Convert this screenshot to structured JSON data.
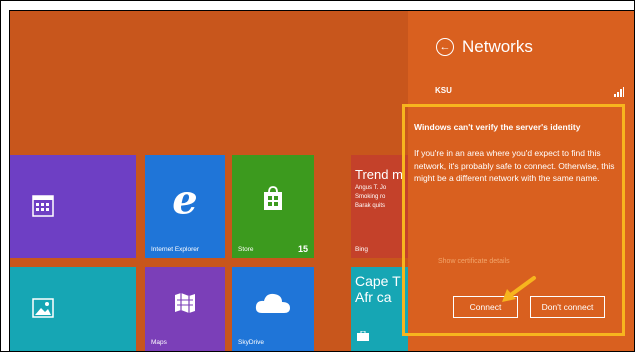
{
  "networks_panel": {
    "title": "Networks",
    "network_name": "KSU",
    "warning_heading": "Windows can't verify the server's identity",
    "warning_body": "If you're in an area where you'd expect to find this network, it's probably safe to connect. Otherwise, this might be a different network with the same name.",
    "details_link": "Show certificate details",
    "connect_label": "Connect",
    "dont_connect_label": "Don't connect"
  },
  "tiles": {
    "ie_label": "Internet Explorer",
    "store_label": "Store",
    "store_badge": "15",
    "news_headline": "Trend m",
    "news_line1": "Angus T. Jo",
    "news_line2": "Smoking ro",
    "news_line3": "Barak quits",
    "news_label": "Bing",
    "maps_label": "Maps",
    "skydrive_label": "SkyDrive",
    "travel_headline1": "Cape T",
    "travel_headline2": "Afr ca"
  },
  "colors": {
    "start_background": "#c8561c",
    "panel_background": "#d9601f",
    "highlight": "#f7b51e",
    "tile_purple": "#6e3fc4",
    "tile_blue": "#1f75d8",
    "tile_green": "#3c9a1e",
    "tile_red": "#c4412a",
    "tile_teal": "#16a6b4"
  }
}
